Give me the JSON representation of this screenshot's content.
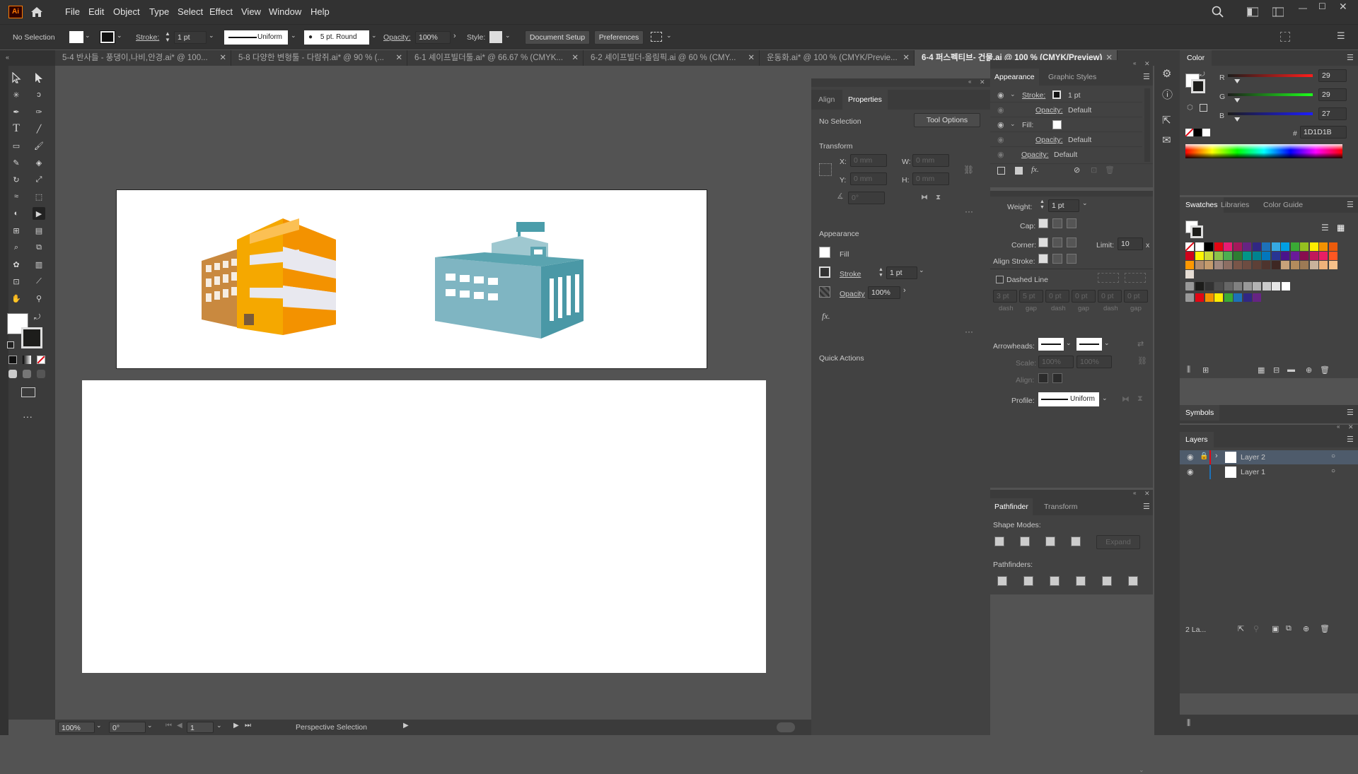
{
  "app": {
    "logo": "Ai",
    "menus": [
      "File",
      "Edit",
      "Object",
      "Type",
      "Select",
      "Effect",
      "View",
      "Window",
      "Help"
    ]
  },
  "control": {
    "selection": "No Selection",
    "stroke_label": "Stroke:",
    "stroke_value": "1 pt",
    "stroke_profile": "Uniform",
    "brush": "5 pt. Round",
    "opacity_label": "Opacity:",
    "opacity_value": "100%",
    "style_label": "Style:",
    "doc_setup": "Document Setup",
    "preferences": "Preferences"
  },
  "tabs": [
    "5-4 반사들 - 풍댕이,나비,안경.ai* @ 100...",
    "5-8 다양한 변형툴 - 다람쥐.ai* @ 90 % (...",
    "6-1 셰이프빌더툴.ai* @ 66.67 % (CMYK...",
    "6-2 셰이프빌더-올림픽.ai @ 60 % (CMY...",
    "운동화.ai* @ 100 % (CMYK/Previe...",
    "6-4 퍼스펙티브- 건물.ai @ 100 % (CMYK/Preview)"
  ],
  "status": {
    "zoom": "100%",
    "rotation": "0°",
    "artboard": "1",
    "tool": "Perspective Selection"
  },
  "properties": {
    "tab_align": "Align",
    "tab_properties": "Properties",
    "no_selection": "No Selection",
    "tool_options": "Tool Options",
    "transform": "Transform",
    "x_label": "X:",
    "y_label": "Y:",
    "w_label": "W:",
    "h_label": "H:",
    "x_value": "0 mm",
    "y_value": "0 mm",
    "w_value": "0 mm",
    "h_value": "0 mm",
    "angle": "0°",
    "appearance": "Appearance",
    "fill": "Fill",
    "stroke": "Stroke",
    "stroke_value": "1 pt",
    "opacity": "Opacity",
    "opacity_value": "100%",
    "fx": "fx.",
    "quick_actions": "Quick Actions"
  },
  "appearance": {
    "tab": "Appearance",
    "tab2": "Graphic Styles",
    "stroke_label": "Stroke:",
    "stroke_value": "1 pt",
    "opacity_label": "Opacity:",
    "opacity_value": "Default",
    "fill_label": "Fill:"
  },
  "stroke_panel": {
    "weight_label": "Weight:",
    "weight_value": "1 pt",
    "cap_label": "Cap:",
    "corner_label": "Corner:",
    "limit_label": "Limit:",
    "limit_value": "10",
    "limit_unit": "x",
    "align_label": "Align Stroke:",
    "dashed": "Dashed Line",
    "dash_values": [
      "3 pt",
      "5 pt",
      "0 pt",
      "0 pt",
      "0 pt",
      "0 pt"
    ],
    "dash_labels": [
      "dash",
      "gap",
      "dash",
      "gap",
      "dash",
      "gap"
    ],
    "arrowheads": "Arrowheads:",
    "scale_label": "Scale:",
    "scale_value1": "100%",
    "scale_value2": "100%",
    "align2_label": "Align:",
    "profile_label": "Profile:",
    "profile_value": "Uniform"
  },
  "pathfinder": {
    "tab": "Pathfinder",
    "tab2": "Transform",
    "shape_modes": "Shape Modes:",
    "expand": "Expand",
    "pathfinders": "Pathfinders:"
  },
  "color": {
    "tab": "Color",
    "r_label": "R",
    "g_label": "G",
    "b_label": "B",
    "r": "29",
    "g": "29",
    "b": "27",
    "r_level": 0.11,
    "g_level": 0.11,
    "b_level": 0.11,
    "hex_label": "#",
    "hex": "1D1D1B"
  },
  "swatches": {
    "tabs": [
      "Swatches",
      "Libraries",
      "Color Guide"
    ],
    "colors": [
      "#ffffff",
      "#000000",
      "#e30613",
      "#e71d73",
      "#a3195b",
      "#662483",
      "#312783",
      "#1d71b8",
      "#36a9e1",
      "#009fe3",
      "#3aaa35",
      "#95c11f",
      "#ffed00",
      "#f39200",
      "#ea5b0c",
      "#d0021b",
      "#fff500",
      "#cddc39",
      "#8bc34a",
      "#4caf50",
      "#2e7d32",
      "#009688",
      "#00838f",
      "#0277bd",
      "#283593",
      "#4a148c",
      "#6a1b9a",
      "#880e4f",
      "#c2185b",
      "#e91e63",
      "#ff5722",
      "#ff9800",
      "#b28c6e",
      "#c49a6c",
      "#a1887f",
      "#8d6e63",
      "#795548",
      "#6d4c41",
      "#5d4037",
      "#4e342e",
      "#3e2723",
      "#c8a27a",
      "#b38b5d",
      "#9c7a55",
      "#c9b29b",
      "#f0b27a",
      "#f7c08a",
      "#e6ddd4"
    ],
    "grays": [
      "#1d1d1b",
      "#333333",
      "#4d4d4d",
      "#666666",
      "#808080",
      "#999999",
      "#b3b3b3",
      "#cccccc",
      "#e6e6e6",
      "#ffffff"
    ],
    "brights": [
      "#e30613",
      "#f39200",
      "#ffed00",
      "#3aaa35",
      "#1d71b8",
      "#312783",
      "#662483"
    ]
  },
  "symbols": {
    "tab": "Symbols"
  },
  "layers": {
    "tab": "Layers",
    "items": [
      "Layer 2",
      "Layer 1"
    ],
    "count": "2 La..."
  }
}
